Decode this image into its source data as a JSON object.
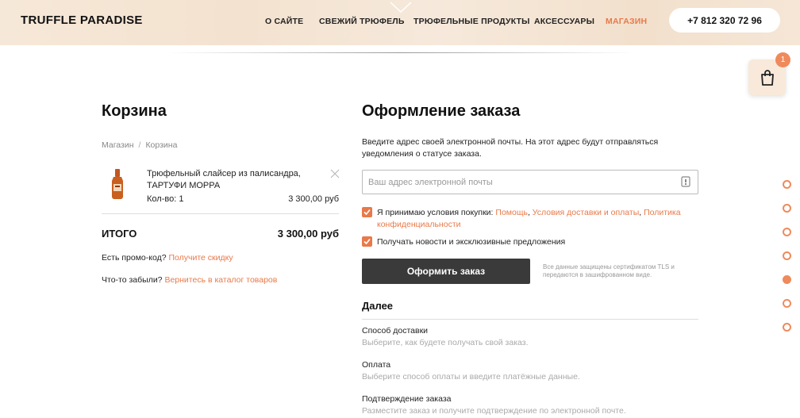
{
  "header": {
    "logo": "TRUFFLE PARADISE",
    "nav": [
      {
        "label": "О САЙТЕ",
        "active": false
      },
      {
        "label": "СВЕЖИЙ ТРЮФЕЛЬ",
        "active": false
      },
      {
        "label": "ТРЮФЕЛЬНЫЕ ПРОДУКТЫ",
        "active": false
      },
      {
        "label": "АКСЕССУАРЫ",
        "active": false
      },
      {
        "label": "МАГАЗИН",
        "active": true
      }
    ],
    "phone": "+7 812 320 72 96"
  },
  "cart_widget": {
    "icon": "shopping-bag-icon",
    "badge": "1"
  },
  "cart": {
    "title": "Корзина",
    "breadcrumb": [
      "Магазин",
      "Корзина"
    ],
    "breadcrumb_sep": "/",
    "item": {
      "name": "Трюфельный слайсер из палисандра, ТАРТУФИ МОРРА",
      "qty": "Кол-во: 1",
      "price": "3 300,00 руб"
    },
    "total_label": "ИТОГО",
    "total_value": "3 300,00 руб",
    "promo_text": "Есть промо-код?",
    "promo_link": "Получите скидку",
    "forgot_text": "Что-то забыли?",
    "forgot_link": "Вернитесь в каталог товаров"
  },
  "checkout": {
    "title": "Оформление заказа",
    "email_note": "Введите адрес своей электронной почты. На этот адрес будут отправляться уведомления о статусе заказа.",
    "email_placeholder": "Ваш адрес электронной почты",
    "email_value": "",
    "terms_prefix": "Я принимаю условия покупки:",
    "terms_link1": "Помощь",
    "terms_link2": "Условия доставки и оплаты",
    "terms_link3": "Политика конфиденциальности",
    "terms_checked": true,
    "news_label": "Получать новости и эксклюзивные предложения",
    "news_checked": true,
    "submit_label": "Оформить заказ",
    "tls_note": "Все данные защищены сертификатом TLS и передаются в зашифрованном виде.",
    "next_title": "Далее",
    "steps": [
      {
        "title": "Способ доставки",
        "desc": "Выберите, как будете получать свой заказ."
      },
      {
        "title": "Оплата",
        "desc": "Выберите способ оплаты и введите платёжные данные."
      },
      {
        "title": "Подтверждение заказа",
        "desc": "Разместите заказ и получите подтверждение по электронной почте."
      }
    ]
  },
  "side_nav": {
    "dots": 7,
    "active_index": 4
  },
  "colors": {
    "accent": "#e8794a",
    "button_dark": "#3a3a3a",
    "header_bg": "#f5e6d6"
  }
}
